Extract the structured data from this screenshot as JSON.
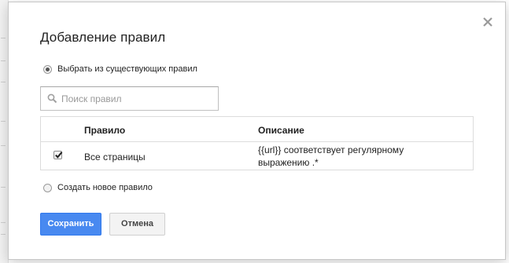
{
  "dialog": {
    "title": "Добавление правил",
    "close_icon": "close-icon"
  },
  "options": {
    "choose_existing_label": "Выбрать из существующих правил",
    "create_new_label": "Создать новое правило",
    "selected": "choose_existing"
  },
  "search": {
    "placeholder": "Поиск правил",
    "value": "",
    "icon": "search-icon"
  },
  "table": {
    "columns": [
      "Правило",
      "Описание"
    ],
    "rows": [
      {
        "checked": true,
        "rule": "Все страницы",
        "description": "{{url}} соответствует регулярному выражению .*"
      }
    ]
  },
  "buttons": {
    "save_label": "Сохранить",
    "cancel_label": "Отмена"
  },
  "colors": {
    "primary_button": "#4889f0",
    "secondary_button": "#f3f3f3"
  }
}
